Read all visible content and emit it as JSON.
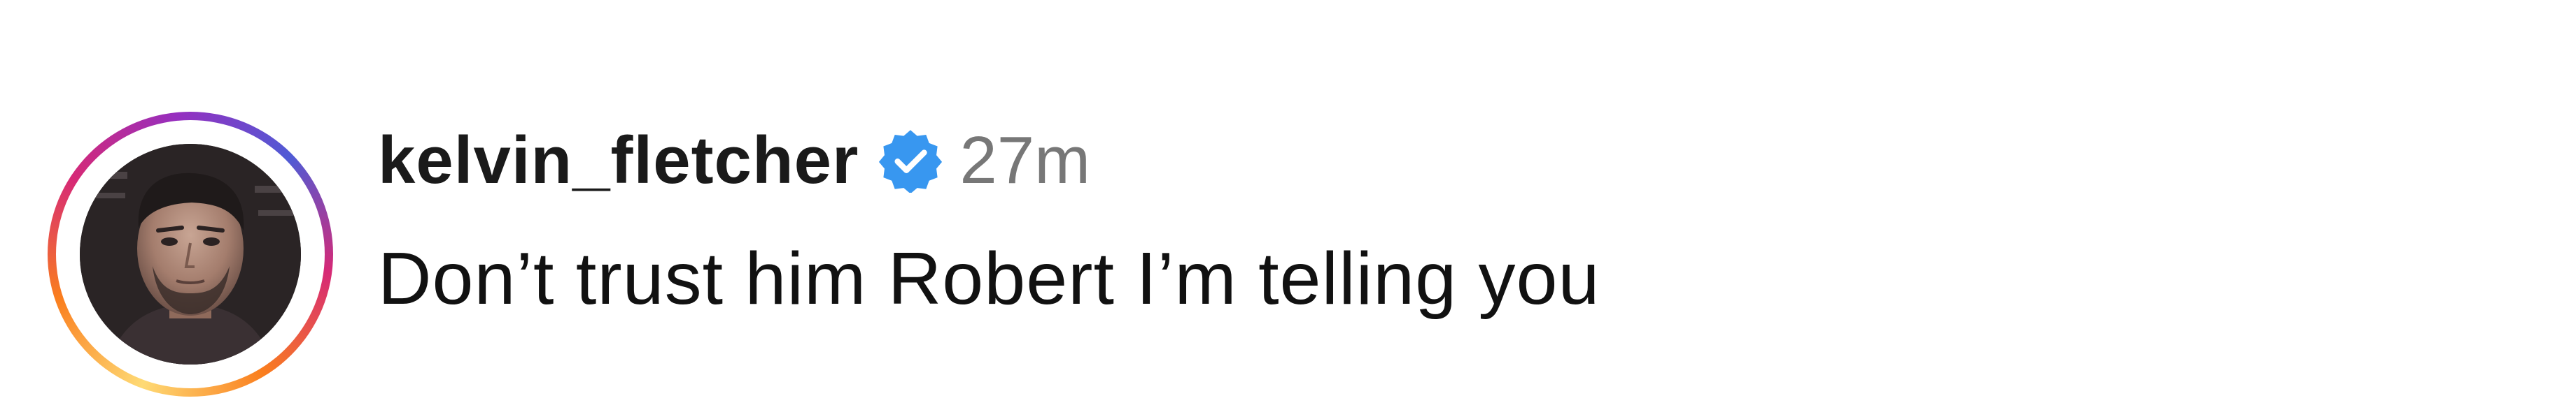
{
  "comment": {
    "username": "kelvin_fletcher",
    "timestamp": "27m",
    "text": "Don’t trust him Robert I’m telling you",
    "verified": true
  },
  "icons": {
    "verified": "verified-badge-icon",
    "avatar": "profile-photo"
  },
  "colors": {
    "verified_badge": "#3897f0",
    "timestamp": "#777777",
    "story_ring": [
      "#feda75",
      "#fa7e1e",
      "#d62976",
      "#962fbf",
      "#4f5bd5"
    ]
  }
}
